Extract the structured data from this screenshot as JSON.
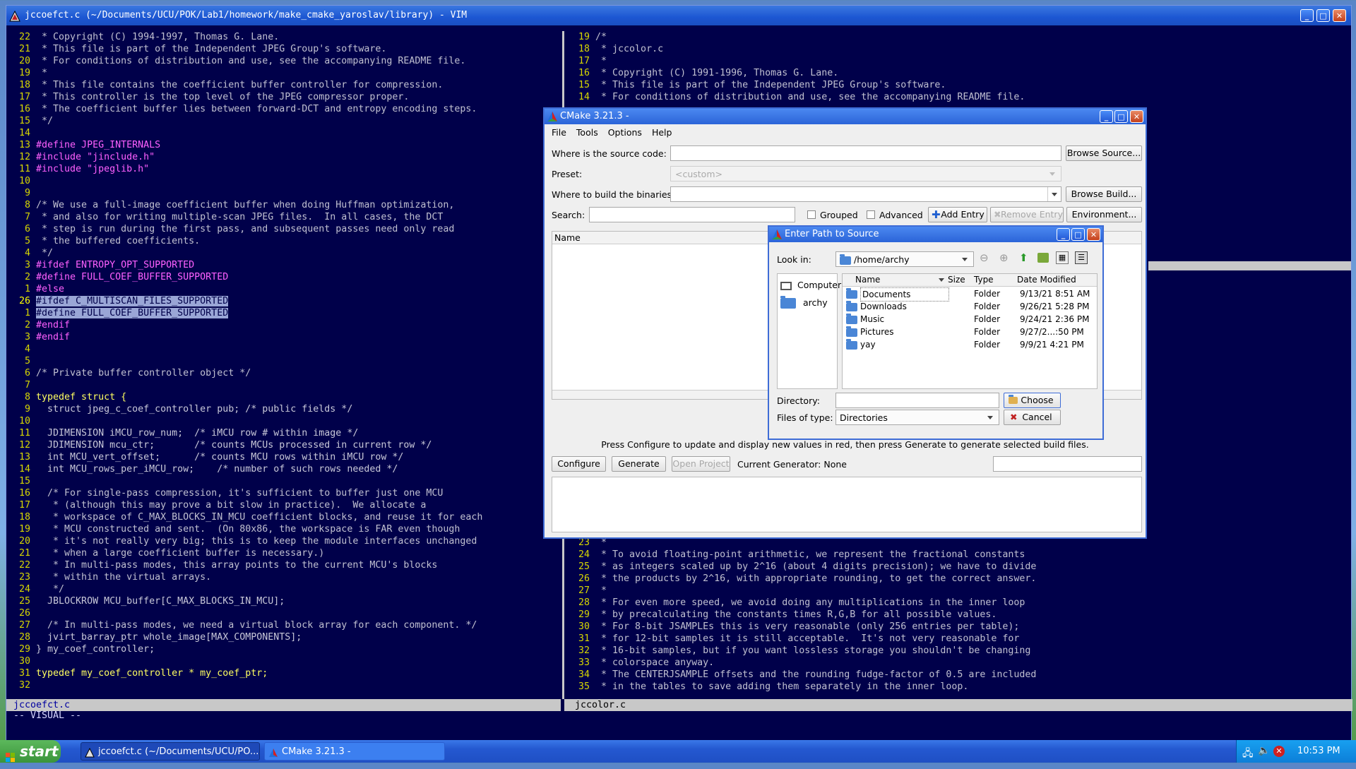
{
  "vim": {
    "title": "jccoefct.c (~/Documents/UCU/POK/Lab1/homework/make_cmake_yaroslav/library) - VIM",
    "status_left": "jccoefct.c",
    "status_right": "jccolor.c",
    "mode": "-- VISUAL --",
    "left_lines": [
      {
        "n": "22",
        "t": " * Copyright (C) 1994-1997, Thomas G. Lane.",
        "c": "comment"
      },
      {
        "n": "21",
        "t": " * This file is part of the Independent JPEG Group's software.",
        "c": "comment"
      },
      {
        "n": "20",
        "t": " * For conditions of distribution and use, see the accompanying README file.",
        "c": "comment"
      },
      {
        "n": "19",
        "t": " *",
        "c": "comment"
      },
      {
        "n": "18",
        "t": " * This file contains the coefficient buffer controller for compression.",
        "c": "comment"
      },
      {
        "n": "17",
        "t": " * This controller is the top level of the JPEG compressor proper.",
        "c": "comment"
      },
      {
        "n": "16",
        "t": " * The coefficient buffer lies between forward-DCT and entropy encoding steps.",
        "c": "comment"
      },
      {
        "n": "15",
        "t": " */",
        "c": "comment"
      },
      {
        "n": "14",
        "t": "",
        "c": ""
      },
      {
        "n": "13",
        "t": "#define JPEG_INTERNALS",
        "c": "pre"
      },
      {
        "n": "12",
        "t": "#include \"jinclude.h\"",
        "c": "pre"
      },
      {
        "n": "11",
        "t": "#include \"jpeglib.h\"",
        "c": "pre"
      },
      {
        "n": "10",
        "t": "",
        "c": ""
      },
      {
        "n": "9",
        "t": "",
        "c": ""
      },
      {
        "n": "8",
        "t": "/* We use a full-image coefficient buffer when doing Huffman optimization,",
        "c": "comment"
      },
      {
        "n": "7",
        "t": " * and also for writing multiple-scan JPEG files.  In all cases, the DCT",
        "c": "comment"
      },
      {
        "n": "6",
        "t": " * step is run during the first pass, and subsequent passes need only read",
        "c": "comment"
      },
      {
        "n": "5",
        "t": " * the buffered coefficients.",
        "c": "comment"
      },
      {
        "n": "4",
        "t": " */",
        "c": "comment"
      },
      {
        "n": "3",
        "t": "#ifdef ENTROPY_OPT_SUPPORTED",
        "c": "pre"
      },
      {
        "n": "2",
        "t": "#define FULL_COEF_BUFFER_SUPPORTED",
        "c": "pre"
      },
      {
        "n": "1",
        "t": "#else",
        "c": "pre"
      },
      {
        "n": "26",
        "t": "#ifdef C_MULTISCAN_FILES_SUPPORTED",
        "c": "sel-cur"
      },
      {
        "n": "1",
        "t": "#define FULL_COEF_BUFFER_SUPPORTED",
        "c": "sel"
      },
      {
        "n": "2",
        "t": "#endif",
        "c": "pre"
      },
      {
        "n": "3",
        "t": "#endif",
        "c": "pre"
      },
      {
        "n": "4",
        "t": "",
        "c": ""
      },
      {
        "n": "5",
        "t": "",
        "c": ""
      },
      {
        "n": "6",
        "t": "/* Private buffer controller object */",
        "c": "comment"
      },
      {
        "n": "7",
        "t": "",
        "c": ""
      },
      {
        "n": "8",
        "t": "typedef struct {",
        "c": "key"
      },
      {
        "n": "9",
        "t": "  struct jpeg_c_coef_controller pub; /* public fields */",
        "c": ""
      },
      {
        "n": "10",
        "t": "",
        "c": ""
      },
      {
        "n": "11",
        "t": "  JDIMENSION iMCU_row_num;  /* iMCU row # within image */",
        "c": ""
      },
      {
        "n": "12",
        "t": "  JDIMENSION mcu_ctr;       /* counts MCUs processed in current row */",
        "c": ""
      },
      {
        "n": "13",
        "t": "  int MCU_vert_offset;      /* counts MCU rows within iMCU row */",
        "c": ""
      },
      {
        "n": "14",
        "t": "  int MCU_rows_per_iMCU_row;    /* number of such rows needed */",
        "c": ""
      },
      {
        "n": "15",
        "t": "",
        "c": ""
      },
      {
        "n": "16",
        "t": "  /* For single-pass compression, it's sufficient to buffer just one MCU",
        "c": "comment"
      },
      {
        "n": "17",
        "t": "   * (although this may prove a bit slow in practice).  We allocate a",
        "c": "comment"
      },
      {
        "n": "18",
        "t": "   * workspace of C_MAX_BLOCKS_IN_MCU coefficient blocks, and reuse it for each",
        "c": "comment"
      },
      {
        "n": "19",
        "t": "   * MCU constructed and sent.  (On 80x86, the workspace is FAR even though",
        "c": "comment"
      },
      {
        "n": "20",
        "t": "   * it's not really very big; this is to keep the module interfaces unchanged",
        "c": "comment"
      },
      {
        "n": "21",
        "t": "   * when a large coefficient buffer is necessary.)",
        "c": "comment"
      },
      {
        "n": "22",
        "t": "   * In multi-pass modes, this array points to the current MCU's blocks",
        "c": "comment"
      },
      {
        "n": "23",
        "t": "   * within the virtual arrays.",
        "c": "comment"
      },
      {
        "n": "24",
        "t": "   */",
        "c": "comment"
      },
      {
        "n": "25",
        "t": "  JBLOCKROW MCU_buffer[C_MAX_BLOCKS_IN_MCU];",
        "c": ""
      },
      {
        "n": "26",
        "t": "",
        "c": ""
      },
      {
        "n": "27",
        "t": "  /* In multi-pass modes, we need a virtual block array for each component. */",
        "c": "comment"
      },
      {
        "n": "28",
        "t": "  jvirt_barray_ptr whole_image[MAX_COMPONENTS];",
        "c": ""
      },
      {
        "n": "29",
        "t": "} my_coef_controller;",
        "c": ""
      },
      {
        "n": "30",
        "t": "",
        "c": ""
      },
      {
        "n": "31",
        "t": "typedef my_coef_controller * my_coef_ptr;",
        "c": "key"
      },
      {
        "n": "32",
        "t": "",
        "c": ""
      }
    ],
    "right_lines_top": [
      {
        "n": "19",
        "t": "/*",
        "c": "comment"
      },
      {
        "n": "18",
        "t": " * jccolor.c",
        "c": "comment"
      },
      {
        "n": "17",
        "t": " *",
        "c": "comment"
      },
      {
        "n": "16",
        "t": " * Copyright (C) 1991-1996, Thomas G. Lane.",
        "c": "comment"
      },
      {
        "n": "15",
        "t": " * This file is part of the Independent JPEG Group's software.",
        "c": "comment"
      },
      {
        "n": "14",
        "t": " * For conditions of distribution and use, see the accompanying README file.",
        "c": "comment"
      }
    ],
    "right_lines_bottom": [
      {
        "n": "23",
        "t": " *",
        "c": "comment"
      },
      {
        "n": "24",
        "t": " * To avoid floating-point arithmetic, we represent the fractional constants",
        "c": "comment"
      },
      {
        "n": "25",
        "t": " * as integers scaled up by 2^16 (about 4 digits precision); we have to divide",
        "c": "comment"
      },
      {
        "n": "26",
        "t": " * the products by 2^16, with appropriate rounding, to get the correct answer.",
        "c": "comment"
      },
      {
        "n": "27",
        "t": " *",
        "c": "comment"
      },
      {
        "n": "28",
        "t": " * For even more speed, we avoid doing any multiplications in the inner loop",
        "c": "comment"
      },
      {
        "n": "29",
        "t": " * by precalculating the constants times R,G,B for all possible values.",
        "c": "comment"
      },
      {
        "n": "30",
        "t": " * For 8-bit JSAMPLEs this is very reasonable (only 256 entries per table);",
        "c": "comment"
      },
      {
        "n": "31",
        "t": " * for 12-bit samples it is still acceptable.  It's not very reasonable for",
        "c": "comment"
      },
      {
        "n": "32",
        "t": " * 16-bit samples, but if you want lossless storage you shouldn't be changing",
        "c": "comment"
      },
      {
        "n": "33",
        "t": " * colorspace anyway.",
        "c": "comment"
      },
      {
        "n": "34",
        "t": " * The CENTERJSAMPLE offsets and the rounding fudge-factor of 0.5 are included",
        "c": "comment"
      },
      {
        "n": "35",
        "t": " * in the tables to save adding them separately in the inner loop.",
        "c": "comment"
      }
    ]
  },
  "cmake": {
    "title": "CMake 3.21.3 -",
    "menu": [
      "File",
      "Tools",
      "Options",
      "Help"
    ],
    "source_label": "Where is the source code:",
    "source_value": "",
    "browse_source": "Browse Source...",
    "preset_label": "Preset:",
    "preset_value": "<custom>",
    "build_label": "Where to build the binaries:",
    "build_value": "",
    "browse_build": "Browse Build...",
    "search_label": "Search:",
    "grouped": "Grouped",
    "advanced": "Advanced",
    "add_entry": "Add Entry",
    "remove_entry": "Remove Entry",
    "environment": "Environment...",
    "col_name": "Name",
    "hint": "Press Configure to update and display new values in red, then press Generate to generate selected build files.",
    "configure": "Configure",
    "generate": "Generate",
    "open_project": "Open Project",
    "generator": "Current Generator: None"
  },
  "dialog": {
    "title": "Enter Path to Source",
    "look_in_label": "Look in:",
    "look_in_value": "/home/archy",
    "sidebar": [
      "Computer",
      "archy"
    ],
    "columns": [
      "Name",
      "Size",
      "Type",
      "Date Modified"
    ],
    "files": [
      {
        "name": "Documents",
        "size": "",
        "type": "Folder",
        "date": "9/13/21 8:51 AM"
      },
      {
        "name": "Downloads",
        "size": "",
        "type": "Folder",
        "date": "9/26/21 5:28 PM"
      },
      {
        "name": "Music",
        "size": "",
        "type": "Folder",
        "date": "9/24/21 2:36 PM"
      },
      {
        "name": "Pictures",
        "size": "",
        "type": "Folder",
        "date": "9/27/2...:50 PM"
      },
      {
        "name": "yay",
        "size": "",
        "type": "Folder",
        "date": "9/9/21 4:21 PM"
      }
    ],
    "directory_label": "Directory:",
    "directory_value": "",
    "choose": "Choose",
    "types_label": "Files of type:",
    "types_value": "Directories",
    "cancel": "Cancel"
  },
  "taskbar": {
    "start": "start",
    "tasks": [
      "jccoefct.c (~/Documents/UCU/PO...",
      "CMake 3.21.3 -"
    ],
    "clock": "10:53 PM"
  },
  "colors": {
    "vim_bg": "#00004a",
    "title_blue": "#2b64d8",
    "line_number": "#d8d800",
    "preprocessor": "#ff60ff"
  }
}
